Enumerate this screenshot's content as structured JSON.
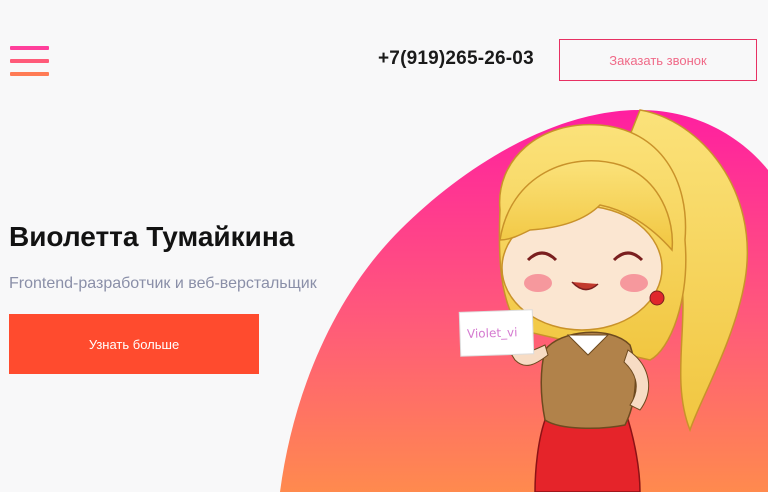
{
  "header": {
    "menu_icon": "hamburger-menu-icon",
    "phone": "+7(919)265-26-03",
    "callback_label": "Заказать звонок"
  },
  "hero": {
    "title": "Виолетта Тумайкина",
    "subtitle": "Frontend-разработчик и веб-верстальщик",
    "cta_label": "Узнать больше",
    "sign_text": "Violet_vi"
  },
  "colors": {
    "accent": "#ff4b2e",
    "pink": "#ff2d8b",
    "orange": "#ff8a3c",
    "outline": "#e73163"
  }
}
